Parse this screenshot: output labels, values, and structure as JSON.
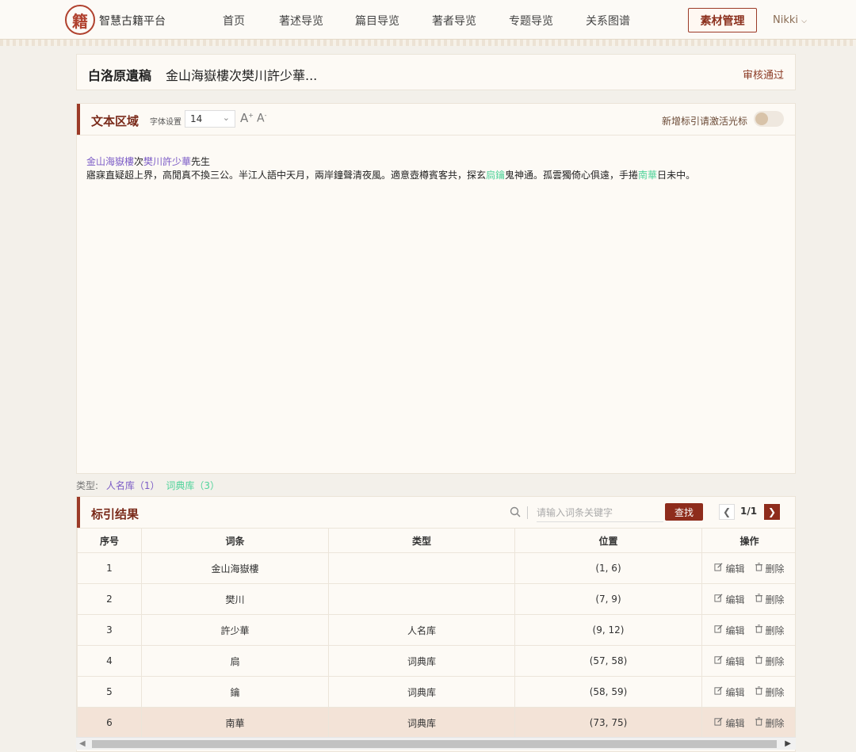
{
  "header": {
    "logo_char": "籍",
    "brand": "智慧古籍平台",
    "nav": [
      "首页",
      "著述导览",
      "篇目导览",
      "著者导览",
      "专题导览",
      "关系图谱"
    ],
    "material_button": "素材管理",
    "user": "Nikki"
  },
  "document": {
    "collection": "白洛原遺稿",
    "title": "金山海嶽樓次樊川許少華...",
    "status": "审核通过"
  },
  "text_area": {
    "title": "文本区域",
    "font_label": "字体设置",
    "font_size": "14",
    "cursor_toggle_label": "新增标引请激活光标",
    "line1": {
      "p1": "金山海嶽樓",
      "p2": "次",
      "p3": "樊川許少華",
      "p4": "先生"
    },
    "line2": {
      "s1": "寤寐直疑超上界，高閒真不換三公。半江人語中天月，兩岸鐘聲清夜風。適意壺樽賓客共，探玄",
      "s2": "扃鑰",
      "s3": "鬼神通。孤雲獨倚心俱遠，手捲",
      "s4": "南華",
      "s5": "日未中。"
    }
  },
  "type_summary": {
    "label": "类型:",
    "person": "人名库（1）",
    "dict": "词典库（3）"
  },
  "results": {
    "title": "标引结果",
    "search_placeholder": "请输入词条关键字",
    "find_button": "查找",
    "page_info": "1/1",
    "columns": [
      "序号",
      "词条",
      "类型",
      "位置",
      "操作"
    ],
    "edit_label": "编辑",
    "delete_label": "删除",
    "rows": [
      {
        "no": "1",
        "term": "金山海嶽樓",
        "type": "",
        "pos": "(1, 6)"
      },
      {
        "no": "2",
        "term": "樊川",
        "type": "",
        "pos": "(7, 9)"
      },
      {
        "no": "3",
        "term": "許少華",
        "type": "人名库",
        "pos": "(9, 12)"
      },
      {
        "no": "4",
        "term": "扃",
        "type": "词典库",
        "pos": "(57, 58)"
      },
      {
        "no": "5",
        "term": "鑰",
        "type": "词典库",
        "pos": "(58, 59)"
      },
      {
        "no": "6",
        "term": "南華",
        "type": "词典库",
        "pos": "(73, 75)"
      }
    ]
  },
  "colors": {
    "accent": "#8e2c1c",
    "person_highlight": "#7b5bc6",
    "dict_highlight": "#4fd39a"
  }
}
